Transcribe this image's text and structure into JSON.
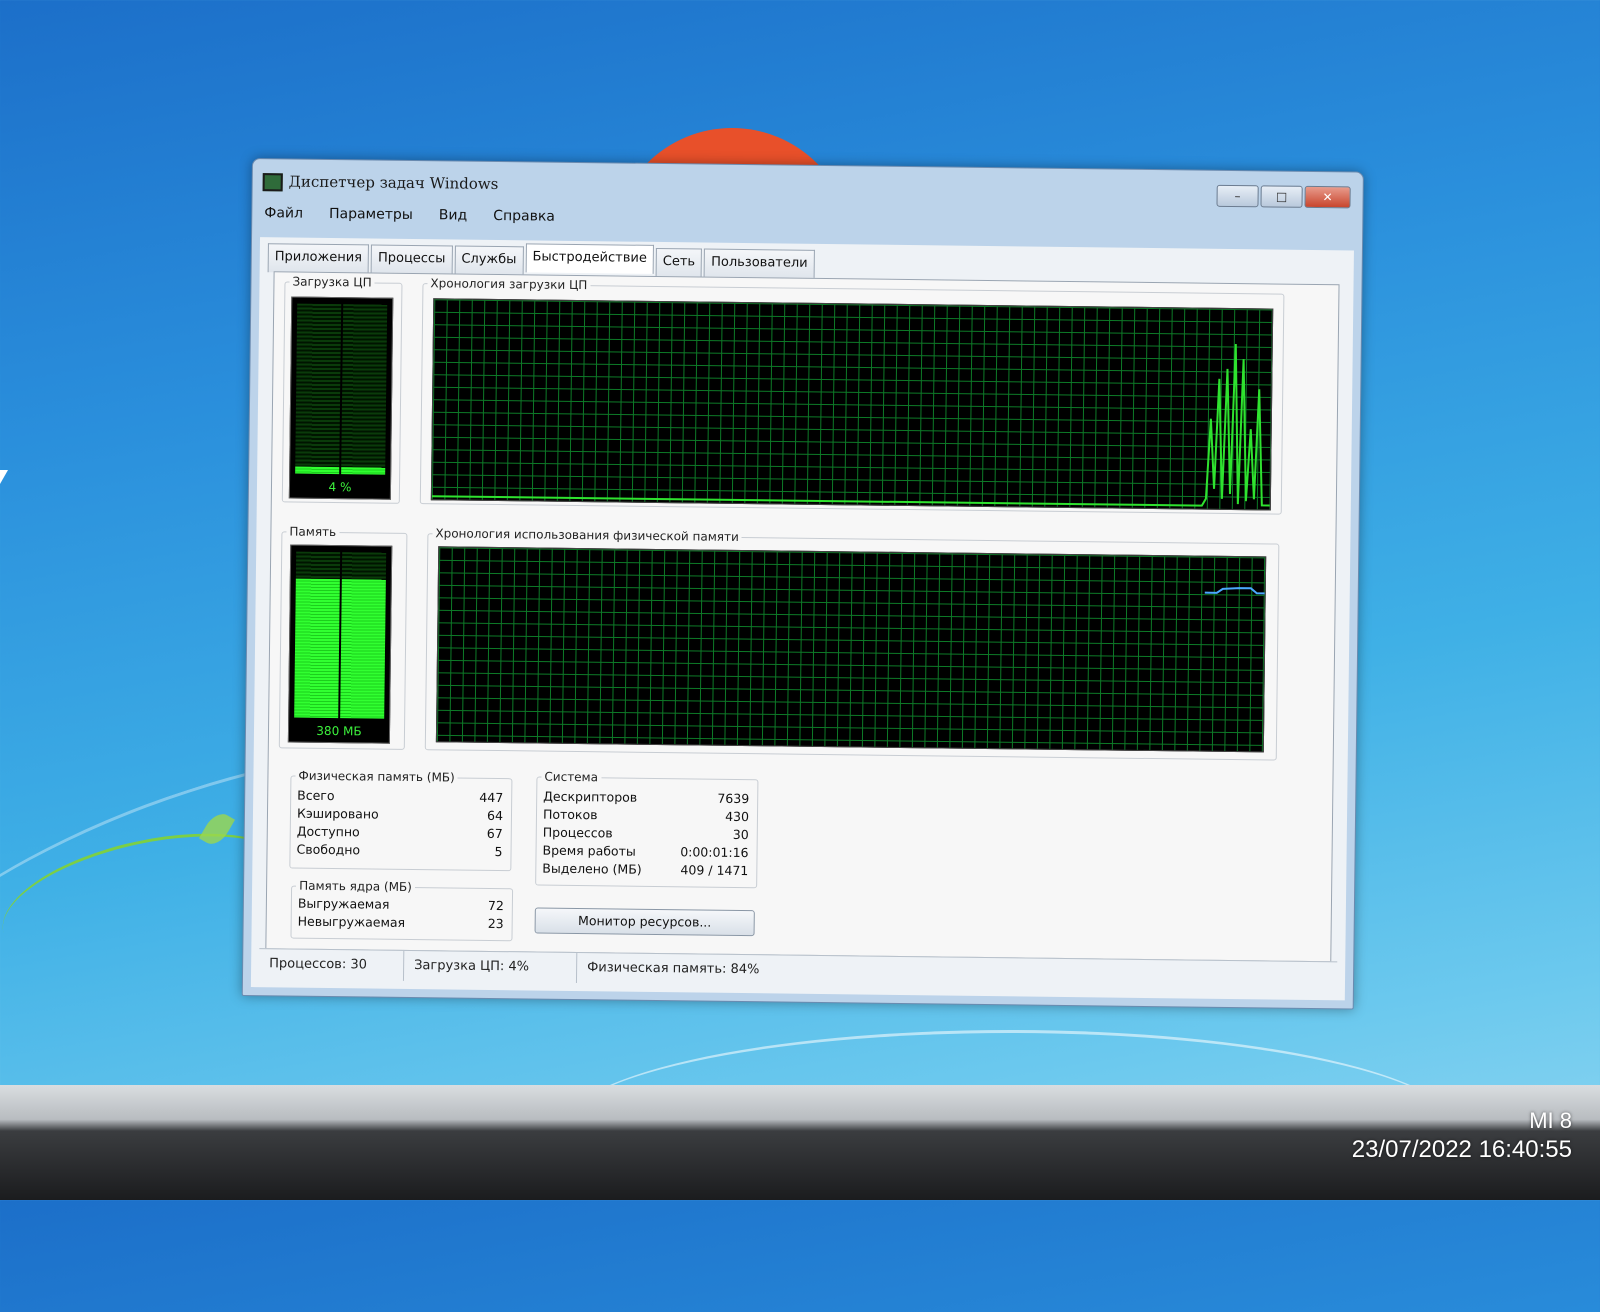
{
  "window": {
    "title": "Диспетчер задач Windows",
    "controls": {
      "minimize": "–",
      "maximize": "□",
      "close": "✕"
    }
  },
  "menu": [
    "Файл",
    "Параметры",
    "Вид",
    "Справка"
  ],
  "tabs": [
    "Приложения",
    "Процессы",
    "Службы",
    "Быстродействие",
    "Сеть",
    "Пользователи"
  ],
  "active_tab": "Быстродействие",
  "performance": {
    "cpu_usage": {
      "label": "Загрузка ЦП",
      "value_text": "4 %",
      "level": 0.04
    },
    "cpu_history": {
      "label": "Хронология загрузки ЦП"
    },
    "memory": {
      "label": "Память",
      "value_text": "380 МБ",
      "level": 0.84
    },
    "memory_history": {
      "label": "Хронология использования физической памяти"
    },
    "physical_memory": {
      "label": "Физическая память (МБ)",
      "rows": [
        {
          "name": "Всего",
          "value": "447"
        },
        {
          "name": "Кэшировано",
          "value": "64"
        },
        {
          "name": "Доступно",
          "value": "67"
        },
        {
          "name": "Свободно",
          "value": "5"
        }
      ]
    },
    "kernel_memory": {
      "label": "Память ядра (МБ)",
      "rows": [
        {
          "name": "Выгружаемая",
          "value": "72"
        },
        {
          "name": "Невыгружаемая",
          "value": "23"
        }
      ]
    },
    "system": {
      "label": "Система",
      "rows": [
        {
          "name": "Дескрипторов",
          "value": "7639"
        },
        {
          "name": "Потоков",
          "value": "430"
        },
        {
          "name": "Процессов",
          "value": "30"
        },
        {
          "name": "Время работы",
          "value": "0:00:01:16"
        },
        {
          "name": "Выделено (МБ)",
          "value": "409 / 1471"
        }
      ]
    },
    "resource_monitor_button": "Монитор ресурсов..."
  },
  "statusbar": {
    "processes": "Процессов: 30",
    "cpu": "Загрузка ЦП: 4%",
    "memory": "Физическая память: 84%"
  },
  "photo_watermark": {
    "brand": "MI 8",
    "datetime": "23/07/2022 16:40:55"
  },
  "colors": {
    "graph_grid": "#0d7a27",
    "cpu_line": "#2fe22f",
    "memory_line": "#4aa8ff",
    "meter_fill": "#31ff31"
  }
}
